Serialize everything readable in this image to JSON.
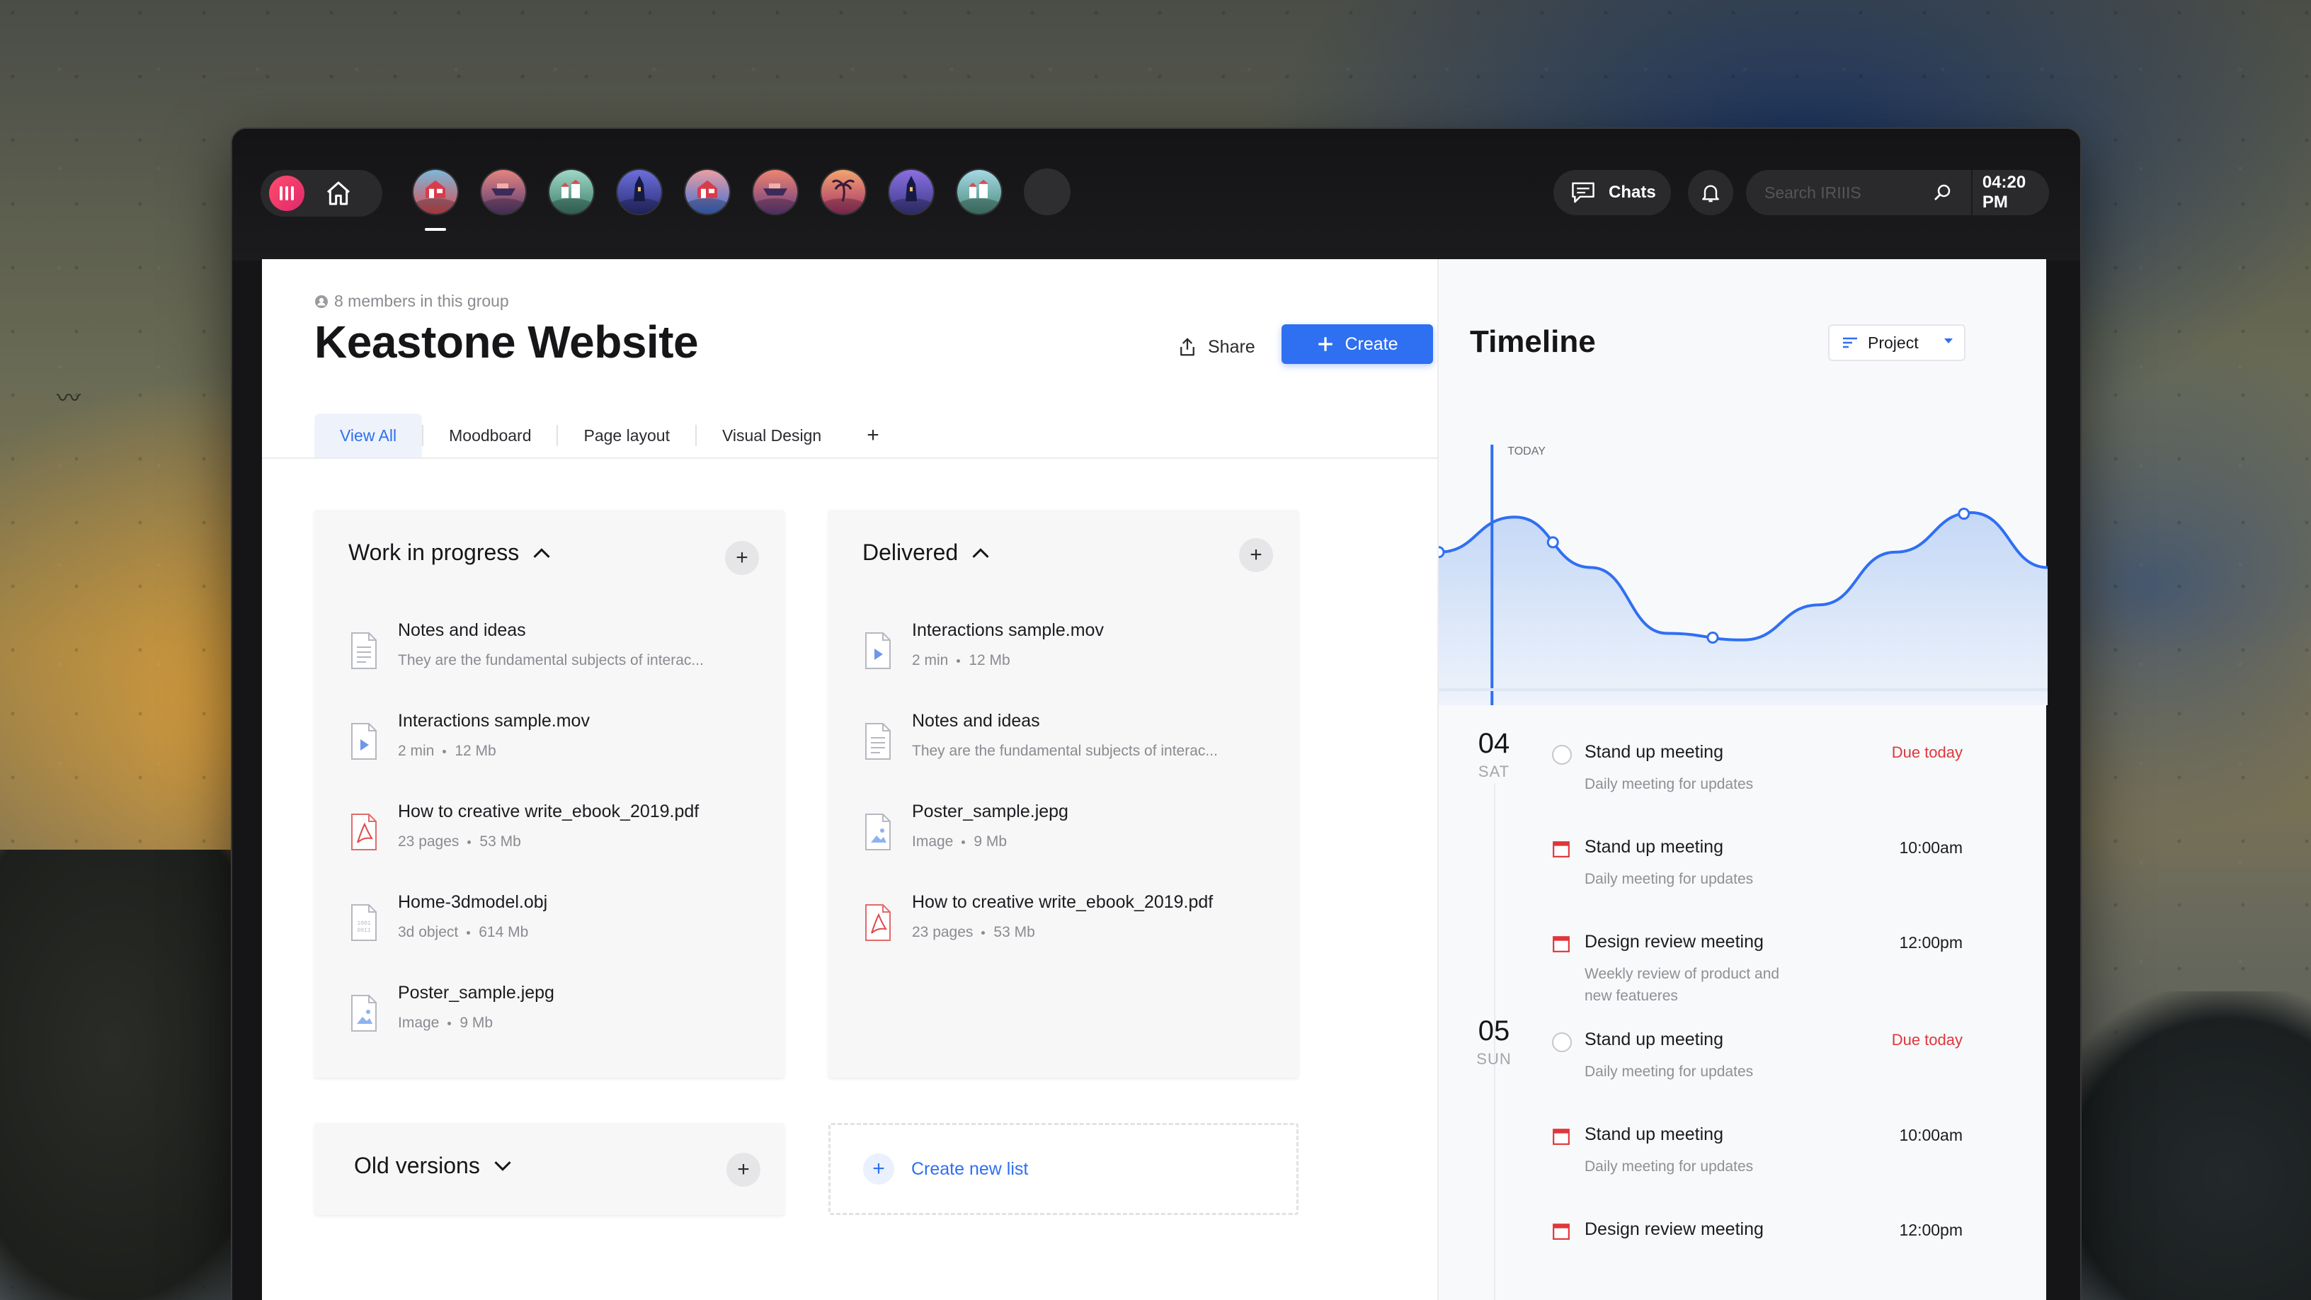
{
  "app": {
    "search_placeholder": "Search IRIIIS",
    "time": "04:20 PM",
    "chats_label": "Chats",
    "avatars": [
      {
        "name": "avatar-1",
        "icon": "house-icon",
        "c1": "#7cb8d8",
        "c2": "#d94b54"
      },
      {
        "name": "avatar-2",
        "icon": "boat-icon",
        "c1": "#e4847e",
        "c2": "#5a3d74"
      },
      {
        "name": "avatar-3",
        "icon": "village-icon",
        "c1": "#9fd7c6",
        "c2": "#3e7f6b"
      },
      {
        "name": "avatar-4",
        "icon": "tower-icon",
        "c1": "#6b6fd9",
        "c2": "#2a2f7a"
      },
      {
        "name": "avatar-5",
        "icon": "house-icon",
        "c1": "#ea9fa2",
        "c2": "#3c6fd6"
      },
      {
        "name": "avatar-6",
        "icon": "boat-icon",
        "c1": "#ee8470",
        "c2": "#6b3d84"
      },
      {
        "name": "avatar-7",
        "icon": "palm-icon",
        "c1": "#f3a56e",
        "c2": "#a7326a"
      },
      {
        "name": "avatar-8",
        "icon": "tower-icon",
        "c1": "#8a6fe0",
        "c2": "#3c3a8a"
      },
      {
        "name": "avatar-9",
        "icon": "village-icon",
        "c1": "#a6d8e6",
        "c2": "#4b8d7a"
      }
    ]
  },
  "project": {
    "members": "8 members in this group",
    "title": "Keastone Website",
    "share_label": "Share",
    "create_label": "Create",
    "tabs": [
      "View All",
      "Moodboard",
      "Page layout",
      "Visual Design"
    ],
    "tab_add": "+"
  },
  "lists": {
    "wip": {
      "title": "Work in progress",
      "files": [
        {
          "type": "doc",
          "name": "Notes and ideas",
          "meta": [
            "They are the fundamental subjects of interac..."
          ]
        },
        {
          "type": "video",
          "name": "Interactions sample.mov",
          "meta": [
            "2 min",
            "12 Mb"
          ]
        },
        {
          "type": "pdf",
          "name": "How to creative write_ebook_2019.pdf",
          "meta": [
            "23 pages",
            "53 Mb"
          ]
        },
        {
          "type": "obj",
          "name": "Home-3dmodel.obj",
          "meta": [
            "3d object",
            "614 Mb"
          ]
        },
        {
          "type": "image",
          "name": "Poster_sample.jepg",
          "meta": [
            "Image",
            "9 Mb"
          ]
        }
      ]
    },
    "delivered": {
      "title": "Delivered",
      "files": [
        {
          "type": "video",
          "name": "Interactions sample.mov",
          "meta": [
            "2 min",
            "12 Mb"
          ]
        },
        {
          "type": "doc",
          "name": "Notes and ideas",
          "meta": [
            "They are the fundamental subjects of interac..."
          ]
        },
        {
          "type": "image",
          "name": "Poster_sample.jepg",
          "meta": [
            "Image",
            "9 Mb"
          ]
        },
        {
          "type": "pdf",
          "name": "How to creative write_ebook_2019.pdf",
          "meta": [
            "23 pages",
            "53 Mb"
          ]
        }
      ]
    },
    "old": {
      "title": "Old versions"
    },
    "create_new": "Create new list"
  },
  "timeline": {
    "title": "Timeline",
    "filter": "Project",
    "today_label": "TODAY",
    "chart_data": {
      "type": "area",
      "x": [
        0,
        1,
        2,
        3,
        4,
        5,
        6,
        7,
        8
      ],
      "y": [
        0.62,
        0.78,
        0.55,
        0.25,
        0.22,
        0.38,
        0.62,
        0.8,
        0.55
      ],
      "today_index": 0.7,
      "points_marked": [
        0,
        1.5,
        3.6,
        6.9
      ]
    },
    "days": [
      {
        "num": "04",
        "weekday": "SAT",
        "events": [
          {
            "icon": "radio",
            "title": "Stand up meeting",
            "desc": "Daily meeting for updates",
            "time": "Due today",
            "due": true
          },
          {
            "icon": "calendar",
            "title": "Stand up meeting",
            "desc": "Daily meeting for updates",
            "time": "10:00am",
            "due": false
          },
          {
            "icon": "calendar",
            "title": "Design review meeting",
            "desc": "Weekly review of product and new featueres",
            "time": "12:00pm",
            "due": false
          }
        ]
      },
      {
        "num": "05",
        "weekday": "SUN",
        "events": [
          {
            "icon": "radio",
            "title": "Stand up meeting",
            "desc": "Daily meeting for updates",
            "time": "Due today",
            "due": true
          },
          {
            "icon": "calendar",
            "title": "Stand up meeting",
            "desc": "Daily meeting for updates",
            "time": "10:00am",
            "due": false
          },
          {
            "icon": "calendar",
            "title": "Design review meeting",
            "desc": "",
            "time": "12:00pm",
            "due": false
          }
        ]
      }
    ]
  }
}
